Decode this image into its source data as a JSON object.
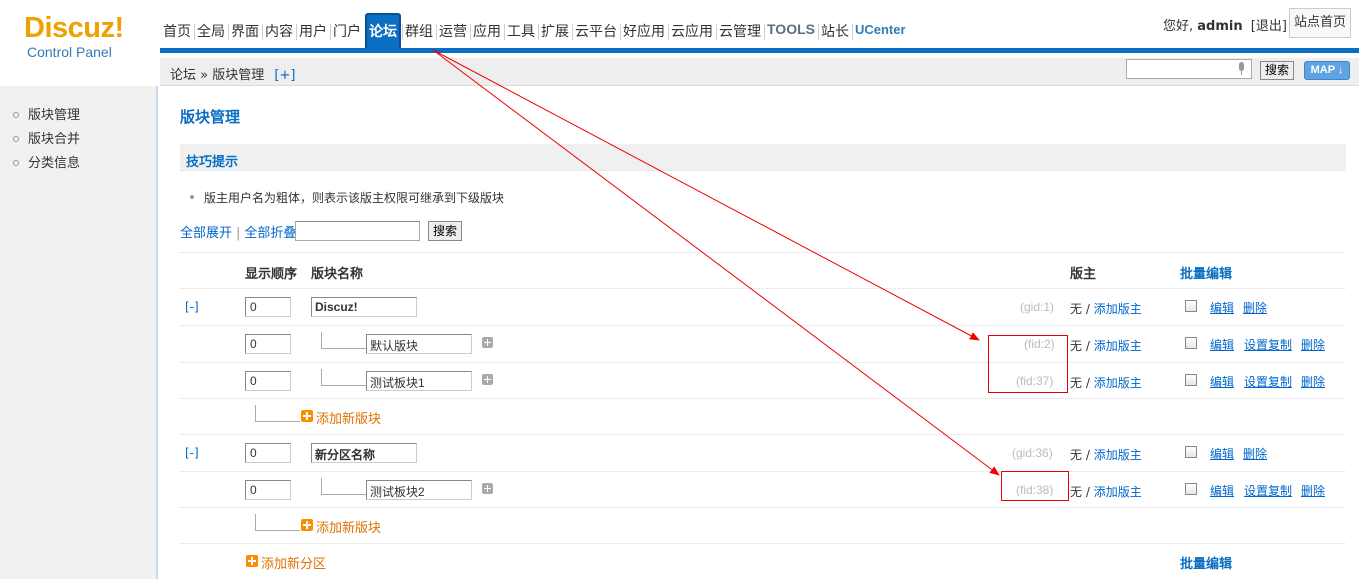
{
  "header": {
    "logo_brand": "Discuz!",
    "logo_sub": "Control Panel",
    "nav": [
      "首页",
      "全局",
      "界面",
      "内容",
      "用户",
      "门户",
      "论坛",
      "群组",
      "运营",
      "应用",
      "工具",
      "扩展",
      "云平台",
      "好应用",
      "云应用",
      "云管理",
      "TOOLS",
      "站长",
      "UCenter"
    ],
    "active_nav": "论坛",
    "greeting_prefix": "您好,",
    "username": "admin",
    "logout": "[退出]",
    "site_home": "站点首页"
  },
  "subbar": {
    "crumb_root": "论坛",
    "crumb_sep": "»",
    "crumb_current": "版块管理",
    "crumb_add": "[+]",
    "search_button": "搜索",
    "map_button": "MAP ↓"
  },
  "sidebar": {
    "items": [
      "版块管理",
      "版块合并",
      "分类信息"
    ]
  },
  "main": {
    "title": "版块管理",
    "tips_title": "技巧提示",
    "tip": "版主用户名为粗体，则表示该版主权限可继承到下级版块",
    "expand_all": "全部展开",
    "collapse_all": "全部折叠",
    "search_button": "搜索",
    "col_order": "显示顺序",
    "col_name": "版块名称",
    "col_moderator": "版主",
    "col_batch": "批量编辑",
    "add_forum": "添加新版块",
    "add_category": "添加新分区",
    "batch_bottom": "批量编辑"
  },
  "rows": {
    "cat1": {
      "toggle": "[-]",
      "order": "0",
      "name": "Discuz!",
      "id": "(gid:1)",
      "mod_none": "无",
      "mod_sep": "/",
      "mod_add": "添加版主",
      "edit": "编辑",
      "del": "删除"
    },
    "f1": {
      "order": "0",
      "name": "默认版块",
      "id": "(fid:2)",
      "mod_none": "无",
      "mod_sep": "/",
      "mod_add": "添加版主",
      "edit": "编辑",
      "copy": "设置复制",
      "del": "删除"
    },
    "f2": {
      "order": "0",
      "name": "测试板块1",
      "id": "(fid:37)",
      "mod_none": "无",
      "mod_sep": "/",
      "mod_add": "添加版主",
      "edit": "编辑",
      "copy": "设置复制",
      "del": "删除"
    },
    "cat2": {
      "toggle": "[-]",
      "order": "0",
      "name": "新分区名称",
      "id": "(gid:36)",
      "mod_none": "无",
      "mod_sep": "/",
      "mod_add": "添加版主",
      "edit": "编辑",
      "del": "删除"
    },
    "f3": {
      "order": "0",
      "name": "测试板块2",
      "id": "(fid:38)",
      "mod_none": "无",
      "mod_sep": "/",
      "mod_add": "添加版主",
      "edit": "编辑",
      "copy": "设置复制",
      "del": "删除"
    }
  },
  "colors": {
    "brand": "#f0a000",
    "nav_blue": "#0a6fc2",
    "link": "#0066cc",
    "orange": "#e07000",
    "annotation": "#ee0000"
  }
}
